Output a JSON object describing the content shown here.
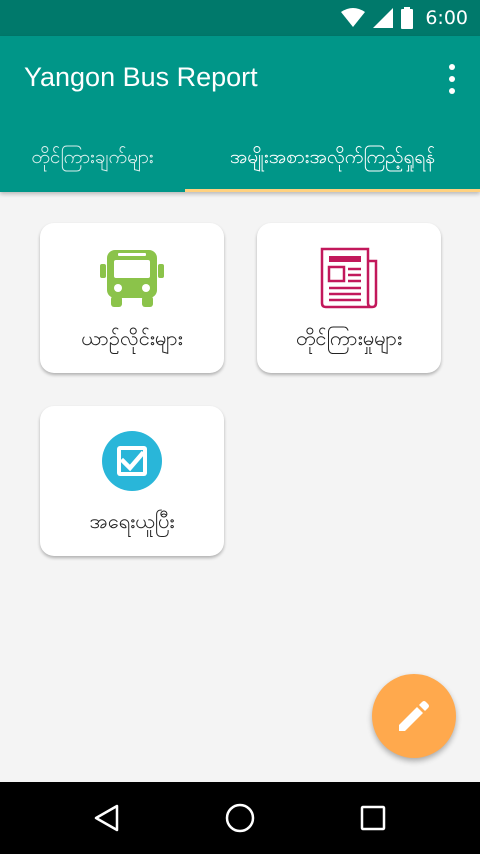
{
  "status_bar": {
    "time": "6:00"
  },
  "app_bar": {
    "title": "Yangon Bus Report",
    "overflow_icon": "more-vert-icon"
  },
  "tabs": [
    {
      "label": "တိုင်ကြားချက်များ",
      "selected": false
    },
    {
      "label": "အမျိုးအစားအလိုက်ကြည့်ရှုရန်",
      "selected": true
    }
  ],
  "cards": [
    {
      "label": "ယာဉ်လိုင်းများ",
      "icon": "bus-icon",
      "icon_color": "#8bc34a"
    },
    {
      "label": "တိုင်ကြားမှုများ",
      "icon": "newspaper-icon",
      "icon_color": "#c2185b"
    },
    {
      "label": "အရေးယူပြီး",
      "icon": "checkbox-icon",
      "icon_color": "#29b6d9"
    }
  ],
  "fab": {
    "icon": "edit-pencil-icon",
    "color": "#ffa94d"
  },
  "colors": {
    "primary": "#009688",
    "primary_dark": "#00796b",
    "tab_indicator": "#ffd180"
  }
}
